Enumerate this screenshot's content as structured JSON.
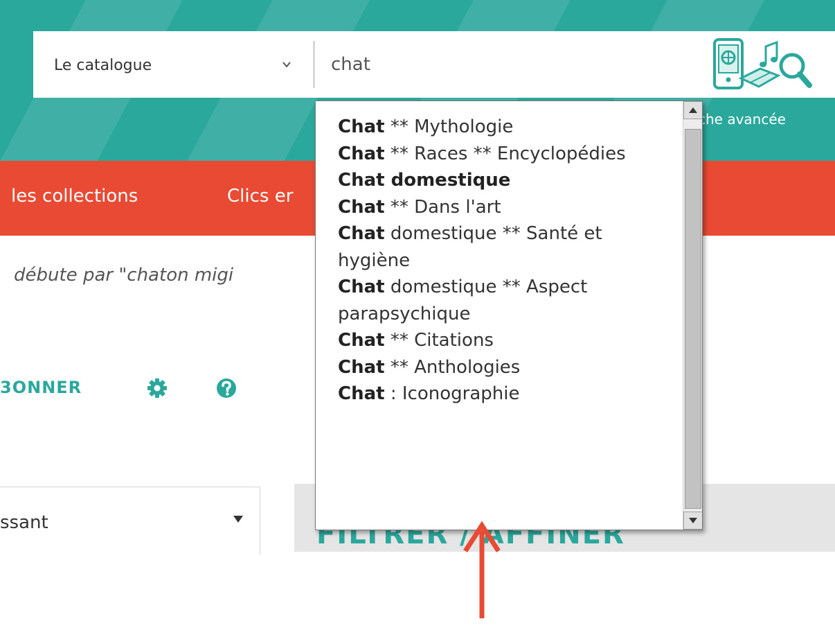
{
  "colors": {
    "teal": "#2ba89c",
    "nav_red": "#e84a33",
    "annotation_arrow": "#e84a33"
  },
  "search": {
    "scope_value": "Le catalogue",
    "query_value": "chat",
    "advanced_link": "che avancée"
  },
  "nav": {
    "items": [
      "les collections",
      "Clics er"
    ]
  },
  "results": {
    "info": "débute par \"chaton migi"
  },
  "actions": {
    "subscribe_label": "3ONNER"
  },
  "sort": {
    "value": "ssant"
  },
  "filter": {
    "heading": "FILTRER / AFFINER"
  },
  "autocomplete": {
    "suggestions": [
      {
        "bold": "Chat",
        "rest": " ** Mythologie"
      },
      {
        "bold": "Chat",
        "rest": " ** Races ** Encyclopédies"
      },
      {
        "bold": "Chat domestique",
        "rest": ""
      },
      {
        "bold": "Chat",
        "rest": " ** Dans l'art"
      },
      {
        "bold": "Chat",
        "rest": " domestique ** Santé et hygiène"
      },
      {
        "bold": "Chat",
        "rest": " domestique ** Aspect parapsychique"
      },
      {
        "bold": "Chat",
        "rest": " ** Citations"
      },
      {
        "bold": "Chat",
        "rest": " ** Anthologies"
      },
      {
        "bold": "Chat",
        "rest": " : Iconographie"
      }
    ]
  }
}
